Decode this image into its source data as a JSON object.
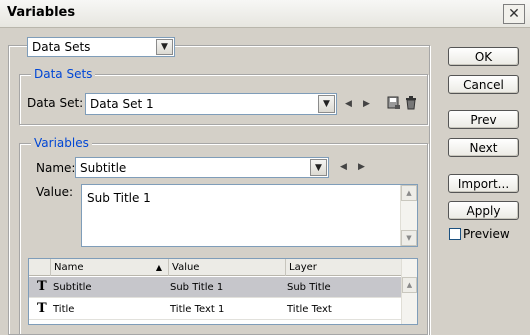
{
  "window": {
    "title": "Variables",
    "close_glyph": "✕"
  },
  "top_select": {
    "value": "Data Sets"
  },
  "data_sets_group": {
    "legend": "Data Sets",
    "field_label": "Data Set:",
    "value": "Data Set 1"
  },
  "variables_group": {
    "legend": "Variables",
    "name_label": "Name:",
    "name_value": "Subtitle",
    "value_label": "Value:",
    "value_text": "Sub Title 1"
  },
  "table": {
    "columns": [
      "Name",
      "Value",
      "Layer"
    ],
    "sort_glyph": "▲",
    "rows": [
      {
        "icon": "T",
        "name": "Subtitle",
        "value": "Sub Title 1",
        "layer": "Sub Title"
      },
      {
        "icon": "T",
        "name": "Title",
        "value": "Title Text 1",
        "layer": "Title Text"
      }
    ]
  },
  "buttons": {
    "ok": "OK",
    "cancel": "Cancel",
    "prev": "Prev",
    "next": "Next",
    "import": "Import...",
    "apply": "Apply"
  },
  "preview": {
    "label": "Preview",
    "checked": false
  },
  "icons": {
    "prev_arrow": "◀",
    "next_arrow": "▶",
    "dropdown": "▼",
    "scroll_up": "▲",
    "scroll_down": "▼"
  },
  "colors": {
    "accent": "#0046d5",
    "selected_row": "#c6c6cb"
  }
}
